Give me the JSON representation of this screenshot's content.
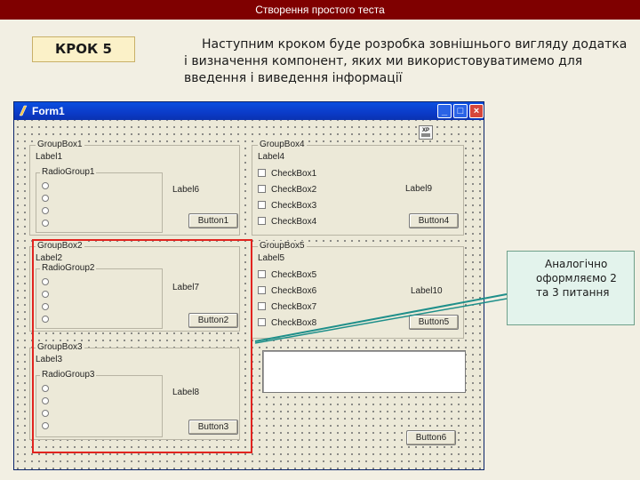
{
  "slide": {
    "title": "Створення простого теста",
    "step": "КРОК 5",
    "intro": "Наступним кроком буде розробка зовнішнього вигляду додатка і визначення компонент, яких ми використовуватимемо для введення і виведення інформації",
    "callout": "Аналогічно оформляємо 2 та 3 питання"
  },
  "form": {
    "title": "Form1",
    "window_buttons": [
      "minimize-icon",
      "maximize-icon",
      "close-icon"
    ],
    "xp_icon_label": "XP",
    "groups": [
      {
        "caption": "GroupBox1",
        "label": "Label1",
        "radiogroup": "RadioGroup1",
        "side_label": "Label6",
        "button": "Button1"
      },
      {
        "caption": "GroupBox2",
        "label": "Label2",
        "radiogroup": "RadioGroup2",
        "side_label": "Label7",
        "button": "Button2"
      },
      {
        "caption": "GroupBox3",
        "label": "Label3",
        "radiogroup": "RadioGroup3",
        "side_label": "Label8",
        "button": "Button3"
      },
      {
        "caption": "GroupBox4",
        "label": "Label4",
        "checkboxes": [
          "CheckBox1",
          "CheckBox2",
          "CheckBox3",
          "CheckBox4"
        ],
        "side_label": "Label9",
        "button": "Button4"
      },
      {
        "caption": "GroupBox5",
        "label": "Label5",
        "checkboxes": [
          "CheckBox5",
          "CheckBox6",
          "CheckBox7",
          "CheckBox8"
        ],
        "side_label": "Label10",
        "button": "Button5"
      }
    ],
    "button6": "Button6"
  },
  "colors": {
    "title_bar": "#7f0000",
    "highlight": "#e1241f",
    "callout_bg": "#e3f3ec",
    "arrow": "#1e8f8a"
  }
}
